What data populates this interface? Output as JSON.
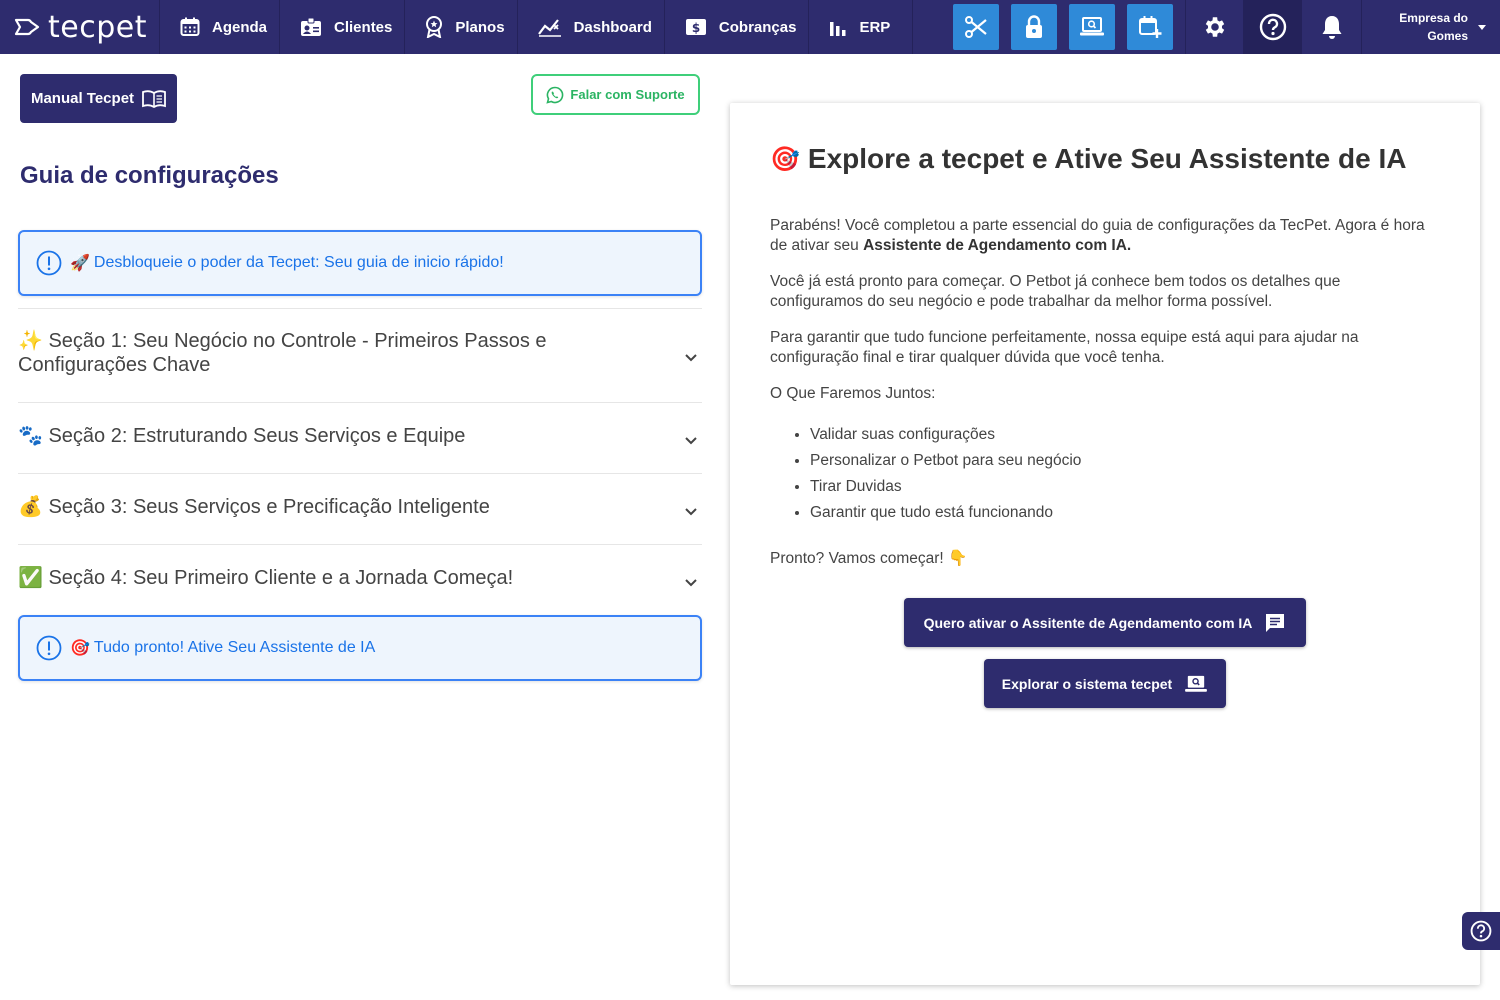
{
  "topbar": {
    "logo_text": "tecpet",
    "nav": [
      {
        "label": "Agenda",
        "icon": "calendar-icon"
      },
      {
        "label": "Clientes",
        "icon": "contact-card-icon"
      },
      {
        "label": "Planos",
        "icon": "award-icon"
      },
      {
        "label": "Dashboard",
        "icon": "chart-line-icon"
      },
      {
        "label": "Cobranças",
        "icon": "dollar-icon"
      },
      {
        "label": "ERP",
        "icon": "bar-chart-icon"
      }
    ],
    "quick_actions": [
      "scissors-icon",
      "lock-icon",
      "laptop-search-icon",
      "calendar-add-icon"
    ],
    "company_line1": "Empresa do",
    "company_line2": "Gomes",
    "accent": "#2f8ad8",
    "background": "#2e2c6e"
  },
  "left": {
    "manual_button": "Manual Tecpet",
    "support_button": "Falar com Suporte",
    "guide_title": "Guia de configurações",
    "alert_top": {
      "emoji": "🚀",
      "text": "Desbloqueie o poder da Tecpet: Seu guia de inicio rápido!"
    },
    "sections": [
      {
        "emoji": "✨",
        "label": "Seção 1: Seu Negócio no Controle - Primeiros Passos e Configurações Chave"
      },
      {
        "emoji": "🐾",
        "label": "Seção 2: Estruturando Seus Serviços e Equipe"
      },
      {
        "emoji": "💰",
        "label": "Seção 3: Seus Serviços e Precificação Inteligente"
      },
      {
        "emoji": "✅",
        "label": "Seção 4: Seu Primeiro Cliente e a Jornada Começa!"
      }
    ],
    "alert_bottom": {
      "emoji": "🎯",
      "text": "Tudo pronto! Ative Seu Assistente de IA"
    }
  },
  "panel": {
    "title_emoji": "🎯",
    "title": "Explore a tecpet e Ative Seu Assistente de IA",
    "p1_start": "Parabéns! Você completou a parte essencial do guia de configurações da TecPet. Agora é hora de ativar seu ",
    "p1_bold": "Assistente de Agendamento com IA.",
    "p2": "Você já está pronto para começar. O Petbot já conhece bem todos os detalhes que configuramos do seu negócio e pode trabalhar da melhor forma possível.",
    "p3": "Para garantir que tudo funcione perfeitamente, nossa equipe está aqui para ajudar na configuração final e tirar qualquer dúvida que você tenha.",
    "p4": "O Que Faremos Juntos:",
    "list": [
      "Validar suas configurações",
      "Personalizar o Petbot para seu negócio",
      "Tirar Duvidas",
      "Garantir que tudo está funcionando"
    ],
    "p5": "Pronto? Vamos começar!",
    "p5_emoji": "👇",
    "button_ia": "Quero ativar o Assitente de Agendamento com IA",
    "button_explore": "Explorar o sistema tecpet"
  }
}
